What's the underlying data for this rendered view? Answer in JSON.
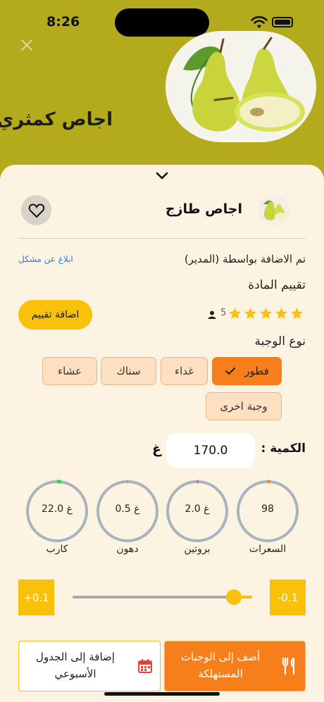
{
  "status_bar": {
    "time": "8:26"
  },
  "header": {
    "title": "اجاص كمثري"
  },
  "item": {
    "name": "اجاص طازج",
    "added_by": "تم الاضافة بواسطة (المدير)",
    "report_link": "ابلاغ عن مشكل"
  },
  "rating": {
    "title": "تقييم المادة",
    "stars": 5,
    "count": "5",
    "add_button": "اضافة تقييم"
  },
  "meal_type": {
    "title": "نوع الوجبة",
    "options": [
      {
        "label": "فطور",
        "selected": true
      },
      {
        "label": "غداء",
        "selected": false
      },
      {
        "label": "سناك",
        "selected": false
      },
      {
        "label": "عشاء",
        "selected": false
      },
      {
        "label": "وجبة اخرى",
        "selected": false
      }
    ]
  },
  "quantity": {
    "label": "الكمية :",
    "value": "170.0",
    "unit": "غ"
  },
  "nutrients": [
    {
      "label": "السعرات",
      "value": "98",
      "color": "#f67f1c"
    },
    {
      "label": "بروتين",
      "value": "2.0 غ",
      "color": "#e5489a"
    },
    {
      "label": "دهون",
      "value": "0.5 غ",
      "color": "#7f8aa0"
    },
    {
      "label": "كارب",
      "value": "22.0 غ",
      "color": "#34d34a"
    }
  ],
  "stepper": {
    "minus": "-0.1",
    "plus": "+0.1",
    "level_fraction": 0.9
  },
  "actions": {
    "schedule": "إضافة إلى الجدول الأسبوعي",
    "eaten": "أضف إلى الوجبات المستهلكة"
  },
  "colors": {
    "header_bg": "#b3ab1c",
    "sheet_bg": "#fdf3e2",
    "accent_yellow": "#f9c109",
    "accent_orange": "#f67f1c",
    "ring_gray": "#a7b3bd"
  }
}
